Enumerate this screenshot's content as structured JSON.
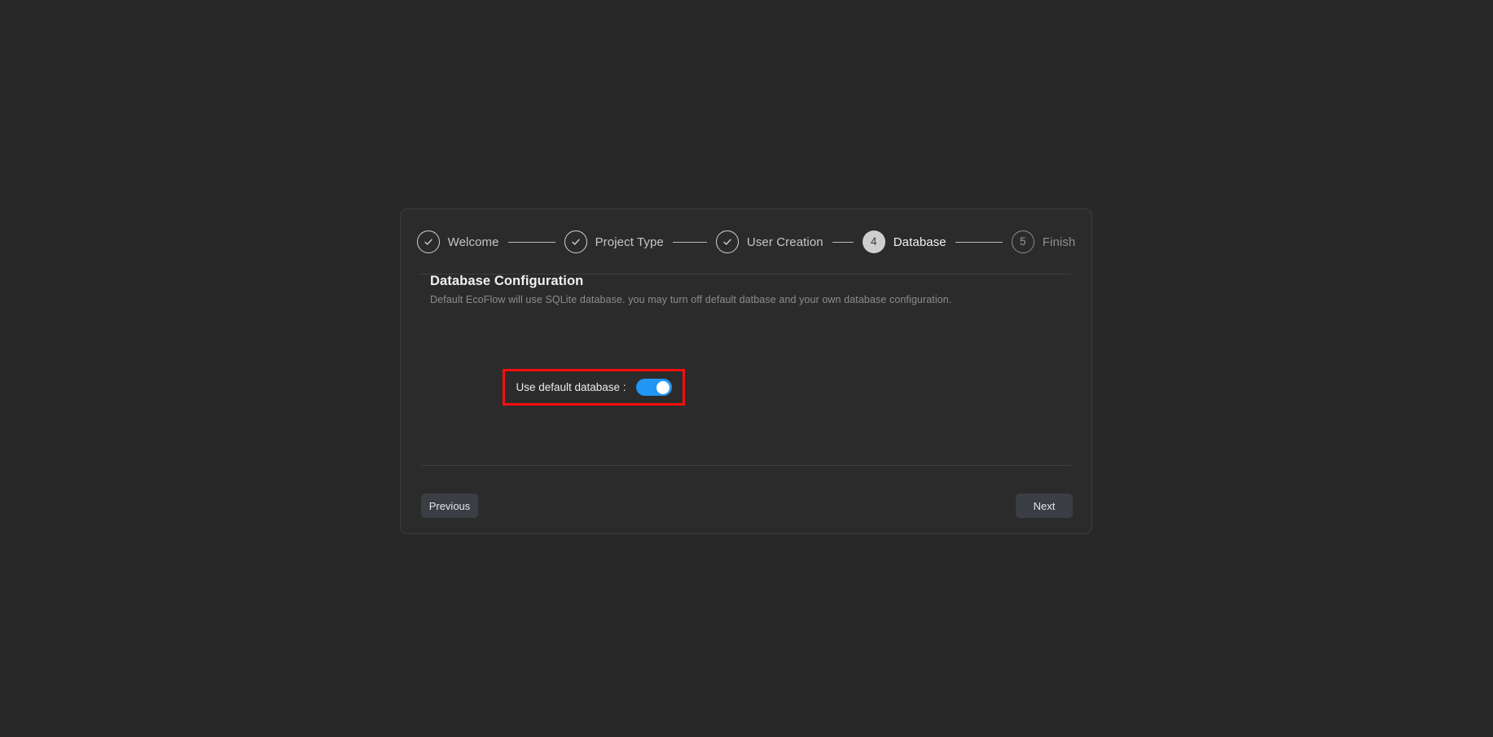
{
  "theme": {
    "page_background": "#282828",
    "card_background": "#2b2b2b",
    "card_border": "#3b3d40",
    "accent_toggle": "#2196f3",
    "highlight_border": "#fa0f0f",
    "active_step_circle": "#cfcfcf",
    "divider": "#3d3f42",
    "button_background": "#3b3e44"
  },
  "stepper": {
    "steps": [
      {
        "index": "1",
        "label": "Welcome",
        "state": "done",
        "marker": "check-icon"
      },
      {
        "index": "2",
        "label": "Project Type",
        "state": "done",
        "marker": "check-icon"
      },
      {
        "index": "3",
        "label": "User Creation",
        "state": "done",
        "marker": "check-icon"
      },
      {
        "index": "4",
        "label": "Database",
        "state": "active",
        "marker": "4"
      },
      {
        "index": "5",
        "label": "Finish",
        "state": "pending",
        "marker": "5"
      }
    ]
  },
  "panel": {
    "title": "Database Configuration",
    "description": "Default EcoFlow will use SQLite database. you may turn off default datbase and your own database configuration."
  },
  "toggle_row": {
    "label": "Use default database :",
    "state": "on",
    "highlighted": true
  },
  "footer": {
    "previous_label": "Previous",
    "next_label": "Next"
  }
}
